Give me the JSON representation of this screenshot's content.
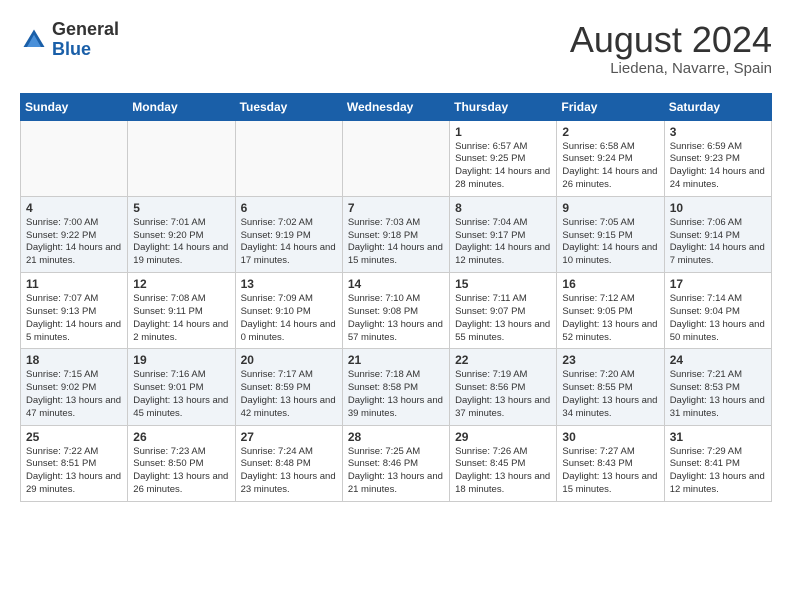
{
  "header": {
    "logo_general": "General",
    "logo_blue": "Blue",
    "month_title": "August 2024",
    "location": "Liedena, Navarre, Spain"
  },
  "days_of_week": [
    "Sunday",
    "Monday",
    "Tuesday",
    "Wednesday",
    "Thursday",
    "Friday",
    "Saturday"
  ],
  "weeks": [
    [
      {
        "num": "",
        "info": ""
      },
      {
        "num": "",
        "info": ""
      },
      {
        "num": "",
        "info": ""
      },
      {
        "num": "",
        "info": ""
      },
      {
        "num": "1",
        "info": "Sunrise: 6:57 AM\nSunset: 9:25 PM\nDaylight: 14 hours\nand 28 minutes."
      },
      {
        "num": "2",
        "info": "Sunrise: 6:58 AM\nSunset: 9:24 PM\nDaylight: 14 hours\nand 26 minutes."
      },
      {
        "num": "3",
        "info": "Sunrise: 6:59 AM\nSunset: 9:23 PM\nDaylight: 14 hours\nand 24 minutes."
      }
    ],
    [
      {
        "num": "4",
        "info": "Sunrise: 7:00 AM\nSunset: 9:22 PM\nDaylight: 14 hours\nand 21 minutes."
      },
      {
        "num": "5",
        "info": "Sunrise: 7:01 AM\nSunset: 9:20 PM\nDaylight: 14 hours\nand 19 minutes."
      },
      {
        "num": "6",
        "info": "Sunrise: 7:02 AM\nSunset: 9:19 PM\nDaylight: 14 hours\nand 17 minutes."
      },
      {
        "num": "7",
        "info": "Sunrise: 7:03 AM\nSunset: 9:18 PM\nDaylight: 14 hours\nand 15 minutes."
      },
      {
        "num": "8",
        "info": "Sunrise: 7:04 AM\nSunset: 9:17 PM\nDaylight: 14 hours\nand 12 minutes."
      },
      {
        "num": "9",
        "info": "Sunrise: 7:05 AM\nSunset: 9:15 PM\nDaylight: 14 hours\nand 10 minutes."
      },
      {
        "num": "10",
        "info": "Sunrise: 7:06 AM\nSunset: 9:14 PM\nDaylight: 14 hours\nand 7 minutes."
      }
    ],
    [
      {
        "num": "11",
        "info": "Sunrise: 7:07 AM\nSunset: 9:13 PM\nDaylight: 14 hours\nand 5 minutes."
      },
      {
        "num": "12",
        "info": "Sunrise: 7:08 AM\nSunset: 9:11 PM\nDaylight: 14 hours\nand 2 minutes."
      },
      {
        "num": "13",
        "info": "Sunrise: 7:09 AM\nSunset: 9:10 PM\nDaylight: 14 hours\nand 0 minutes."
      },
      {
        "num": "14",
        "info": "Sunrise: 7:10 AM\nSunset: 9:08 PM\nDaylight: 13 hours\nand 57 minutes."
      },
      {
        "num": "15",
        "info": "Sunrise: 7:11 AM\nSunset: 9:07 PM\nDaylight: 13 hours\nand 55 minutes."
      },
      {
        "num": "16",
        "info": "Sunrise: 7:12 AM\nSunset: 9:05 PM\nDaylight: 13 hours\nand 52 minutes."
      },
      {
        "num": "17",
        "info": "Sunrise: 7:14 AM\nSunset: 9:04 PM\nDaylight: 13 hours\nand 50 minutes."
      }
    ],
    [
      {
        "num": "18",
        "info": "Sunrise: 7:15 AM\nSunset: 9:02 PM\nDaylight: 13 hours\nand 47 minutes."
      },
      {
        "num": "19",
        "info": "Sunrise: 7:16 AM\nSunset: 9:01 PM\nDaylight: 13 hours\nand 45 minutes."
      },
      {
        "num": "20",
        "info": "Sunrise: 7:17 AM\nSunset: 8:59 PM\nDaylight: 13 hours\nand 42 minutes."
      },
      {
        "num": "21",
        "info": "Sunrise: 7:18 AM\nSunset: 8:58 PM\nDaylight: 13 hours\nand 39 minutes."
      },
      {
        "num": "22",
        "info": "Sunrise: 7:19 AM\nSunset: 8:56 PM\nDaylight: 13 hours\nand 37 minutes."
      },
      {
        "num": "23",
        "info": "Sunrise: 7:20 AM\nSunset: 8:55 PM\nDaylight: 13 hours\nand 34 minutes."
      },
      {
        "num": "24",
        "info": "Sunrise: 7:21 AM\nSunset: 8:53 PM\nDaylight: 13 hours\nand 31 minutes."
      }
    ],
    [
      {
        "num": "25",
        "info": "Sunrise: 7:22 AM\nSunset: 8:51 PM\nDaylight: 13 hours\nand 29 minutes."
      },
      {
        "num": "26",
        "info": "Sunrise: 7:23 AM\nSunset: 8:50 PM\nDaylight: 13 hours\nand 26 minutes."
      },
      {
        "num": "27",
        "info": "Sunrise: 7:24 AM\nSunset: 8:48 PM\nDaylight: 13 hours\nand 23 minutes."
      },
      {
        "num": "28",
        "info": "Sunrise: 7:25 AM\nSunset: 8:46 PM\nDaylight: 13 hours\nand 21 minutes."
      },
      {
        "num": "29",
        "info": "Sunrise: 7:26 AM\nSunset: 8:45 PM\nDaylight: 13 hours\nand 18 minutes."
      },
      {
        "num": "30",
        "info": "Sunrise: 7:27 AM\nSunset: 8:43 PM\nDaylight: 13 hours\nand 15 minutes."
      },
      {
        "num": "31",
        "info": "Sunrise: 7:29 AM\nSunset: 8:41 PM\nDaylight: 13 hours\nand 12 minutes."
      }
    ]
  ]
}
